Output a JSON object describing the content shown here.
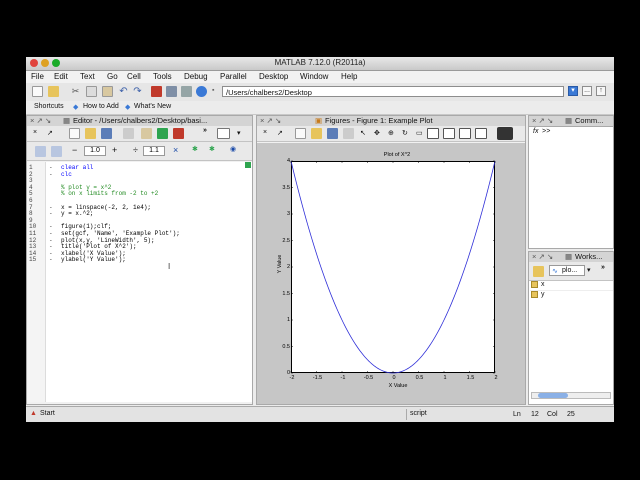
{
  "window": {
    "title": "MATLAB  7.12.0 (R2011a)"
  },
  "menu": [
    "File",
    "Edit",
    "Text",
    "Go",
    "Cell",
    "Tools",
    "Debug",
    "Parallel",
    "Desktop",
    "Window",
    "Help"
  ],
  "toolbar": {
    "current_folder": "/Users/chalbers2/Desktop",
    "browse_label": "...",
    "up_label": "↑"
  },
  "shortcuts": {
    "label": "Shortcuts",
    "how_to_add": "How to Add",
    "whats_new": "What's New"
  },
  "editor": {
    "title": "Editor - /Users/chalbers2/Desktop/basi...",
    "cell_minus": "−",
    "cell_value1": "1.0",
    "cell_plus": "+",
    "cell_divide": "÷",
    "cell_value2": "1.1",
    "cell_close": "×",
    "lines": [
      {
        "n": "1",
        "dash": "-",
        "text": "clear all",
        "cls": "kw"
      },
      {
        "n": "2",
        "dash": "-",
        "text": "clc",
        "cls": "kw"
      },
      {
        "n": "3",
        "dash": "",
        "text": "",
        "cls": ""
      },
      {
        "n": "4",
        "dash": "",
        "text": "% plot y = x^2",
        "cls": "green"
      },
      {
        "n": "5",
        "dash": "",
        "text": "% on x limits from -2 to +2",
        "cls": "green"
      },
      {
        "n": "6",
        "dash": "",
        "text": "",
        "cls": ""
      },
      {
        "n": "7",
        "dash": "-",
        "text": "x = linspace(-2, 2, 1e4);",
        "cls": ""
      },
      {
        "n": "8",
        "dash": "-",
        "text": "y = x.^2;",
        "cls": ""
      },
      {
        "n": "9",
        "dash": "",
        "text": "",
        "cls": ""
      },
      {
        "n": "10",
        "dash": "-",
        "text": "figure(1);clf;",
        "cls": ""
      },
      {
        "n": "11",
        "dash": "-",
        "text": "set(gcf, 'Name', 'Example Plot');",
        "cls": ""
      },
      {
        "n": "12",
        "dash": "-",
        "text": "plot(x,y, 'LineWidth', 5);",
        "cls": ""
      },
      {
        "n": "13",
        "dash": "-",
        "text": "title('Plot of X^2');",
        "cls": ""
      },
      {
        "n": "14",
        "dash": "-",
        "text": "xlabel('X Value');",
        "cls": ""
      },
      {
        "n": "15",
        "dash": "-",
        "text": "ylabel('Y Value');",
        "cls": ""
      }
    ]
  },
  "figure": {
    "panel_title": "Figures - Figure 1: Example Plot"
  },
  "command_window": {
    "title": "Comm...",
    "prompt": ">>",
    "fx": "fx"
  },
  "workspace": {
    "title": "Works...",
    "dropdown": "plo...",
    "variables": [
      "x",
      "y"
    ]
  },
  "status": {
    "mode": "script",
    "ln_label": "Ln",
    "ln": "12",
    "col_label": "Col",
    "col": "25",
    "start": "Start"
  },
  "colors": {
    "curve": "#3030d8",
    "folder_highlight": "#fff",
    "accent": "#3a79d6"
  },
  "chart_data": {
    "type": "line",
    "title": "Plot of X^2",
    "xlabel": "X Value",
    "ylabel": "Y Value",
    "xlim": [
      -2,
      2
    ],
    "ylim": [
      0,
      4
    ],
    "xticks": [
      "-2",
      "-1.5",
      "-1",
      "-0.5",
      "0",
      "0.5",
      "1",
      "1.5",
      "2"
    ],
    "yticks": [
      "0",
      "0.5",
      "1",
      "1.5",
      "2",
      "2.5",
      "3",
      "3.5",
      "4"
    ],
    "series": [
      {
        "function": "y = x^2",
        "x": [
          -2,
          -1.75,
          -1.5,
          -1.25,
          -1,
          -0.75,
          -0.5,
          -0.25,
          0,
          0.25,
          0.5,
          0.75,
          1,
          1.25,
          1.5,
          1.75,
          2
        ],
        "y": [
          4,
          3.0625,
          2.25,
          1.5625,
          1,
          0.5625,
          0.25,
          0.0625,
          0,
          0.0625,
          0.25,
          0.5625,
          1,
          1.5625,
          2.25,
          3.0625,
          4
        ]
      }
    ],
    "grid": false
  }
}
